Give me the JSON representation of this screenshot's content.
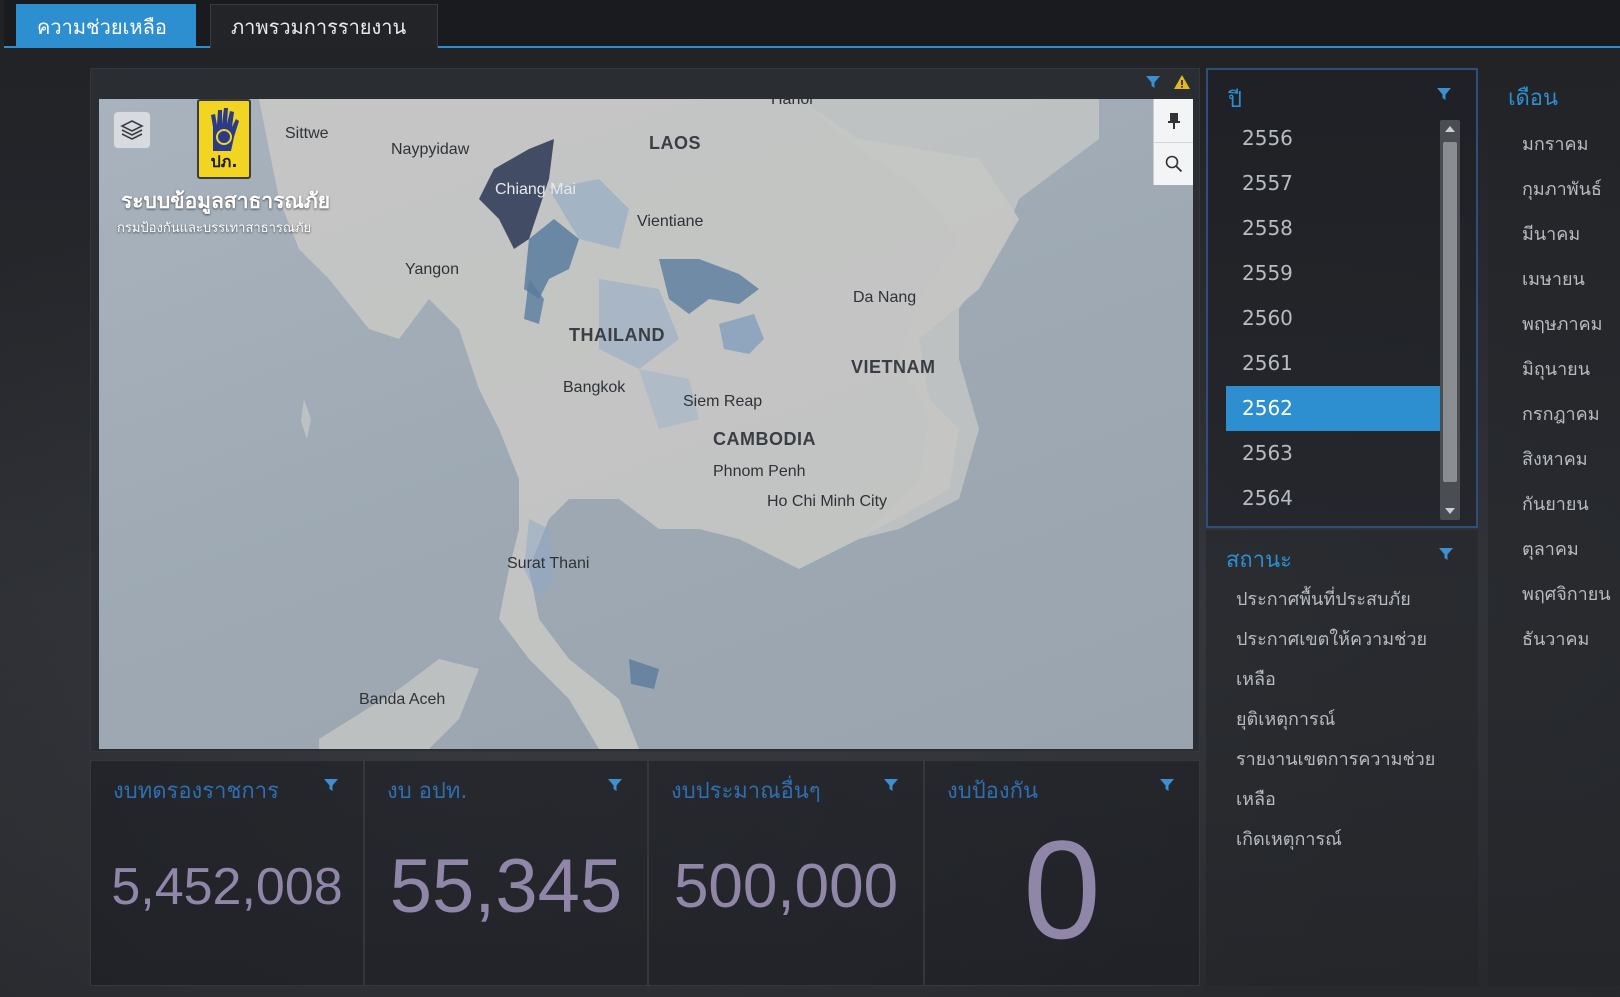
{
  "tabs": {
    "help": "ความช่วยเหลือ",
    "overview": "ภาพรวมการรายงาน"
  },
  "colors": {
    "accent": "#2e8fd0",
    "kpi_value": "#8f86a8",
    "choropleth_dark": "#3b4760",
    "choropleth_mid": "#5b7c9e",
    "choropleth_light": "#8ea8c7"
  },
  "map": {
    "brand_title": "ระบบข้อมูลสาธารณภัย",
    "brand_subtitle": "กรมป้องกันและบรรเทาสาธารณภัย",
    "logo_abbr": "ปภ.",
    "labels": {
      "sittwe": "Sittwe",
      "naypyidaw": "Naypyidaw",
      "laos": "LAOS",
      "hanoi": "Hanoi",
      "chiang_mai": "Chiang Mai",
      "vientiane": "Vientiane",
      "yangon": "Yangon",
      "da_nang": "Da Nang",
      "thailand": "THAILAND",
      "vietnam": "VIETNAM",
      "bangkok": "Bangkok",
      "siem_reap": "Siem Reap",
      "cambodia": "CAMBODIA",
      "phnom_penh": "Phnom Penh",
      "ho_chi_minh": "Ho Chi Minh City",
      "surat_thani": "Surat Thani",
      "banda_aceh": "Banda Aceh"
    }
  },
  "year_slicer": {
    "title": "ปี",
    "items": [
      "2556",
      "2557",
      "2558",
      "2559",
      "2560",
      "2561",
      "2562",
      "2563",
      "2564"
    ],
    "selected": "2562"
  },
  "status_slicer": {
    "title": "สถานะ",
    "items": [
      "ประกาศพื้นที่ประสบภัย",
      "ประกาศเขตให้ความช่วยเหลือ",
      "ยุติเหตุการณ์",
      "รายงานเขตการความช่วยเหลือ",
      "เกิดเหตุการณ์"
    ]
  },
  "month_slicer": {
    "title": "เดือน",
    "items": [
      "มกราคม",
      "กุมภาพันธ์",
      "มีนาคม",
      "เมษายน",
      "พฤษภาคม",
      "มิถุนายน",
      "กรกฎาคม",
      "สิงหาคม",
      "กันยายน",
      "ตุลาคม",
      "พฤศจิกายน",
      "ธันวาคม"
    ]
  },
  "kpis": [
    {
      "title": "งบทดรองราชการ",
      "value": "5,452,008"
    },
    {
      "title": "งบ อปท.",
      "value": "55,345"
    },
    {
      "title": "งบประมาณอื่นๆ",
      "value": "500,000"
    },
    {
      "title": "งบป้องกัน",
      "value": "0"
    }
  ]
}
